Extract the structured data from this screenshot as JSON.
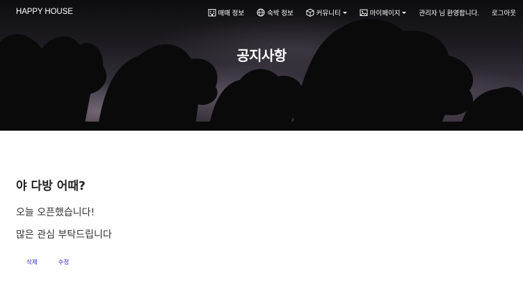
{
  "navbar": {
    "brand": "HAPPY HOUSE",
    "items": [
      {
        "label": "매매 정보",
        "icon": "building-icon"
      },
      {
        "label": "숙박 정보",
        "icon": "globe-icon"
      },
      {
        "label": "커뮤니티",
        "icon": "box-icon",
        "dropdown": true
      },
      {
        "label": "마이페이지",
        "icon": "image-icon",
        "dropdown": true
      }
    ],
    "welcome": "관리자 님 환영합니다.",
    "logout": "로그아웃"
  },
  "hero": {
    "title": "공지사항"
  },
  "post": {
    "title": "야 다방 어때?",
    "body": [
      "오늘 오픈했습니다!",
      "많은 관심 부탁드립니다"
    ]
  },
  "actions": {
    "delete": "삭제",
    "edit": "수정"
  },
  "colors": {
    "link": "#2a2ad8",
    "nav_text": "#ffffff"
  }
}
